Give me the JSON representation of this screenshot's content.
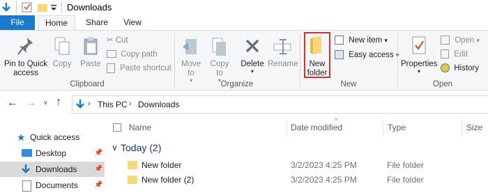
{
  "window": {
    "title": "Downloads"
  },
  "ribbon_tabs": {
    "file": "File",
    "home": "Home",
    "share": "Share",
    "view": "View"
  },
  "clipboard": {
    "pin": "Pin to Quick access",
    "copy": "Copy",
    "paste": "Paste",
    "cut": "Cut",
    "copy_path": "Copy path",
    "paste_shortcut": "Paste shortcut",
    "label": "Clipboard"
  },
  "organize": {
    "move_to": "Move to",
    "copy_to": "Copy to",
    "delete": "Delete",
    "rename": "Rename",
    "label": "Organize"
  },
  "new": {
    "new_folder_line1": "New",
    "new_folder_line2": "folder",
    "new_item": "New item",
    "easy_access": "Easy access",
    "label": "New"
  },
  "open": {
    "properties": "Properties",
    "open": "Open",
    "edit": "Edit",
    "history": "History",
    "label": "Open"
  },
  "address": {
    "crumbs": [
      "This PC",
      "Downloads"
    ]
  },
  "nav": {
    "quick_access": "Quick access",
    "desktop": "Desktop",
    "downloads": "Downloads",
    "documents": "Documents"
  },
  "columns": {
    "name": "Name",
    "date_modified": "Date modified",
    "type": "Type",
    "size": "Size"
  },
  "group": {
    "label": "Today (2)"
  },
  "files": [
    {
      "name": "New folder",
      "date": "3/2/2023 4:25 PM",
      "type": "File folder"
    },
    {
      "name": "New folder (2)",
      "date": "3/2/2023 4:25 PM",
      "type": "File folder"
    }
  ],
  "colors": {
    "accent": "#1979ca",
    "highlight_box": "#d03030",
    "selected_nav": "#cce8ff"
  }
}
